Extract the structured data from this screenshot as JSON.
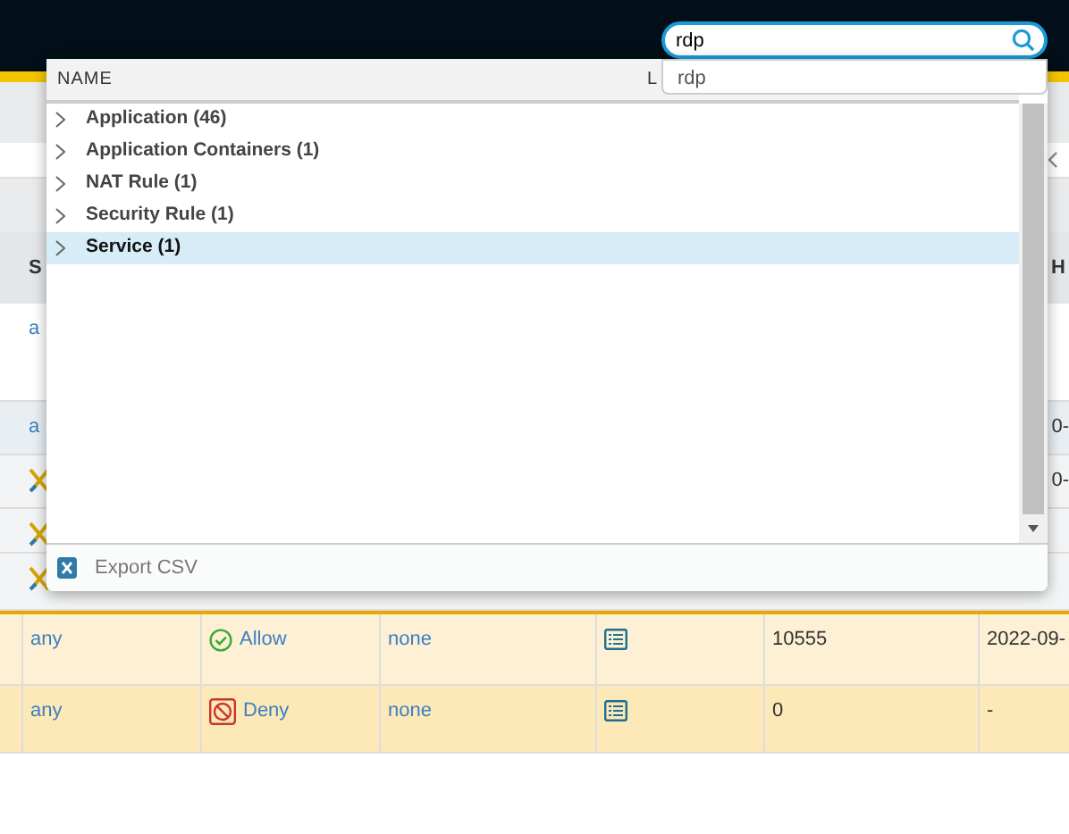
{
  "search": {
    "value": "rdp"
  },
  "suggestions": [
    {
      "text": "rdp"
    }
  ],
  "results": {
    "columns": [
      "NAME",
      "L"
    ],
    "groups": [
      {
        "label": "Application (46)",
        "selected": false,
        "expanded": false
      },
      {
        "label": "Application Containers (1)",
        "selected": false,
        "expanded": false
      },
      {
        "label": "NAT Rule (1)",
        "selected": false,
        "expanded": false
      },
      {
        "label": "Security Rule (1)",
        "selected": false,
        "expanded": false
      },
      {
        "label": "Service (1)",
        "selected": true,
        "expanded": false
      }
    ],
    "export": "Export CSV"
  },
  "table": {
    "header": {
      "left": "S",
      "right": "H"
    },
    "partial_rows": [
      {
        "kind": "text",
        "left": "a",
        "right": ""
      },
      {
        "kind": "text",
        "left": "a",
        "right": "0-"
      },
      {
        "kind": "icon",
        "left": "",
        "right": "0-"
      },
      {
        "kind": "icon",
        "left": "",
        "right": ""
      },
      {
        "kind": "icon",
        "left": "",
        "right": ""
      }
    ],
    "rows": [
      {
        "source": "any",
        "action": {
          "kind": "allow",
          "label": "Allow"
        },
        "profile": "none",
        "hits": "10555",
        "last_hit": "2022-09-",
        "highlighted": false
      },
      {
        "source": "any",
        "action": {
          "kind": "deny",
          "label": "Deny"
        },
        "profile": "none",
        "hits": "0",
        "last_hit": "-",
        "highlighted": true
      }
    ]
  }
}
